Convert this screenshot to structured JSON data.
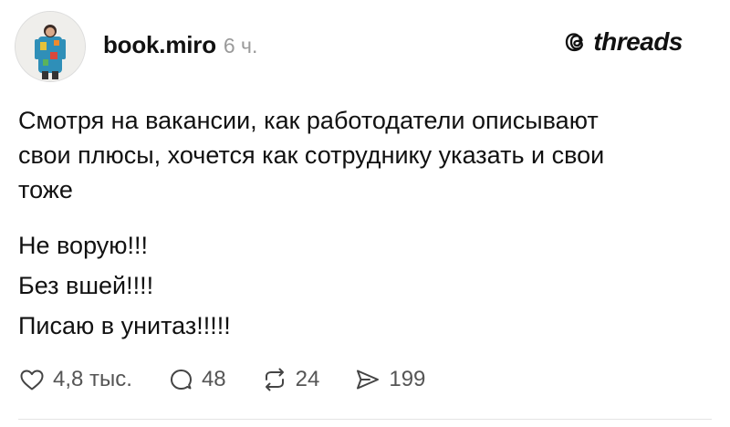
{
  "post": {
    "username": "book.miro",
    "time": "6 ч.",
    "brand": "threads",
    "paragraph": [
      "Смотря на вакансии, как работодатели описывают",
      "свои плюсы, хочется как сотруднику указать и свои",
      "тоже"
    ],
    "lines": [
      "Не ворую!!!",
      "Без вшей!!!!",
      "Писаю в унитаз!!!!!"
    ]
  },
  "actions": {
    "likes": "4,8 тыс.",
    "comments": "48",
    "reposts": "24",
    "shares": "199"
  },
  "icons": {
    "avatar": "avatar-image",
    "brand": "threads-logo-icon",
    "like": "heart-icon",
    "comment": "comment-bubble-icon",
    "repost": "repost-icon",
    "share": "send-icon"
  }
}
